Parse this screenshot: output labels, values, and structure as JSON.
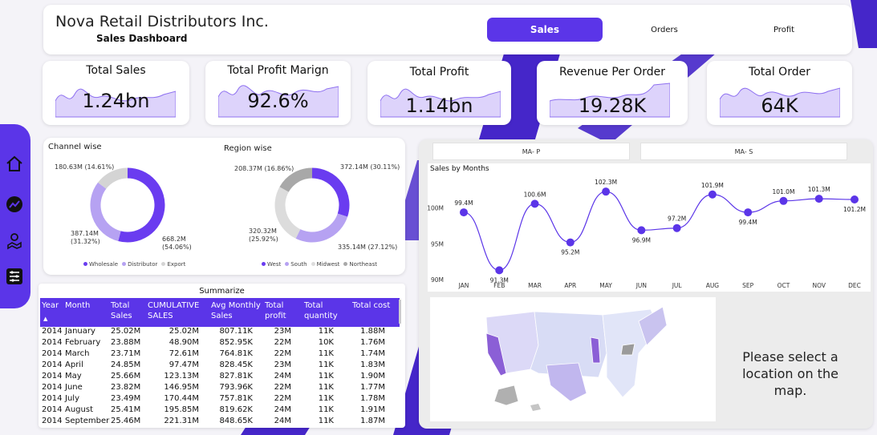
{
  "header": {
    "company": "Nova Retail Distributors Inc.",
    "subtitle": "Sales Dashboard",
    "tabs": [
      {
        "label": "Sales",
        "active": true
      },
      {
        "label": "Orders",
        "active": false
      },
      {
        "label": "Profit",
        "active": false
      }
    ]
  },
  "sidebar": {
    "icons": [
      "home-icon",
      "trend-icon",
      "map-pin-icon",
      "sliders-icon"
    ]
  },
  "kpis": [
    {
      "label": "Total Sales",
      "value": "1.24bn"
    },
    {
      "label": "Total Profit Marign",
      "value": "92.6%"
    },
    {
      "label": "Total Profit",
      "value": "1.14bn"
    },
    {
      "label": "Revenue Per Order",
      "value": "19.28K"
    },
    {
      "label": "Total Order",
      "value": "64K"
    }
  ],
  "channel": {
    "title": "Channel wise",
    "slices": [
      {
        "name": "Wholesale",
        "label": "668.2M",
        "pct_label": "(54.06%)",
        "pct": 54.06,
        "color": "#6a3cf0"
      },
      {
        "name": "Distributor",
        "label": "387.14M",
        "pct_label": "(31.32%)",
        "pct": 31.32,
        "color": "#b6a2f2"
      },
      {
        "name": "Export",
        "label": "180.63M (14.61%)",
        "pct_label": "",
        "pct": 14.61,
        "color": "#d4d4d4"
      }
    ]
  },
  "region": {
    "title": "Region wise",
    "slices": [
      {
        "name": "West",
        "label": "372.14M (30.11%)",
        "pct": 30.11,
        "color": "#6a3cf0"
      },
      {
        "name": "South",
        "label": "335.14M (27.12%)",
        "pct": 27.12,
        "color": "#b6a2f2"
      },
      {
        "name": "Midwest",
        "label": "320.32M",
        "pct_label": "(25.92%)",
        "pct": 25.92,
        "color": "#dcdcdc"
      },
      {
        "name": "Northeast",
        "label": "208.37M (16.86%)",
        "pct": 16.86,
        "color": "#a8a8a8"
      }
    ]
  },
  "summarize": {
    "title": "Summarize",
    "columns": [
      "Year",
      "Month",
      "Total Sales",
      "CUMULATIVE SALES",
      "Avg Monthly Sales",
      "Total profit",
      "Total quantity",
      "Total cost"
    ],
    "rows": [
      [
        "2014",
        "January",
        "25.02M",
        "25.02M",
        "807.11K",
        "23M",
        "11K",
        "1.88M"
      ],
      [
        "2014",
        "February",
        "23.88M",
        "48.90M",
        "852.95K",
        "22M",
        "10K",
        "1.76M"
      ],
      [
        "2014",
        "March",
        "23.71M",
        "72.61M",
        "764.81K",
        "22M",
        "11K",
        "1.74M"
      ],
      [
        "2014",
        "April",
        "24.85M",
        "97.47M",
        "828.45K",
        "23M",
        "11K",
        "1.83M"
      ],
      [
        "2014",
        "May",
        "25.66M",
        "123.13M",
        "827.81K",
        "24M",
        "11K",
        "1.90M"
      ],
      [
        "2014",
        "June",
        "23.82M",
        "146.95M",
        "793.96K",
        "22M",
        "11K",
        "1.77M"
      ],
      [
        "2014",
        "July",
        "23.49M",
        "170.44M",
        "757.81K",
        "22M",
        "11K",
        "1.78M"
      ],
      [
        "2014",
        "August",
        "25.41M",
        "195.85M",
        "819.62K",
        "24M",
        "11K",
        "1.91M"
      ],
      [
        "2014",
        "September",
        "25.46M",
        "221.31M",
        "848.65K",
        "24M",
        "11K",
        "1.87M"
      ]
    ]
  },
  "filters": [
    "MA- P",
    "MA- S"
  ],
  "chart_data": {
    "type": "line",
    "title": "Sales by Months",
    "categories": [
      "JAN",
      "FEB",
      "MAR",
      "APR",
      "MAY",
      "JUN",
      "JUL",
      "AUG",
      "SEP",
      "OCT",
      "NOV",
      "DEC"
    ],
    "values": [
      99.4,
      91.3,
      100.6,
      95.2,
      102.3,
      96.9,
      97.2,
      101.9,
      99.4,
      101.0,
      101.3,
      101.2
    ],
    "data_labels": [
      "99.4M",
      "91.3M",
      "100.6M",
      "95.2M",
      "102.3M",
      "96.9M",
      "97.2M",
      "101.9M",
      "99.4M",
      "101.0M",
      "101.3M",
      "101.2M"
    ],
    "yticks": [
      {
        "v": 100,
        "label": "100M"
      },
      {
        "v": 95,
        "label": "95M"
      },
      {
        "v": 90,
        "label": "90M"
      }
    ],
    "ylim": [
      90,
      104
    ],
    "color": "#5b35e8"
  },
  "map": {
    "message": "Please select a location on the map."
  },
  "colors": {
    "accent": "#5b35e8",
    "light": "#b6a2f2"
  }
}
